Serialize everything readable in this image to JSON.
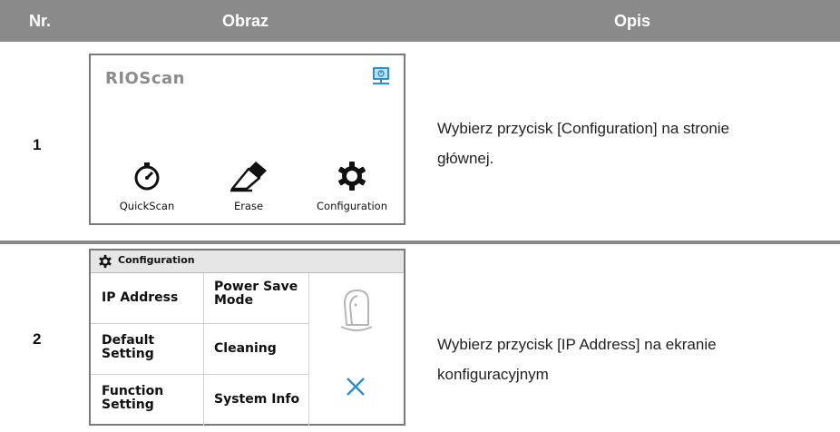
{
  "header": {
    "col_nr": "Nr.",
    "col_image": "Obraz",
    "col_desc": "Opis"
  },
  "rows": [
    {
      "nr": "1",
      "desc_line1": "Wybierz przycisk [Configuration] na stronie",
      "desc_line2": "głównej.",
      "screen": {
        "logo": "RIOScan",
        "tiles": [
          {
            "label": "QuickScan",
            "icon": "stopwatch-icon"
          },
          {
            "label": "Erase",
            "icon": "eraser-icon"
          },
          {
            "label": "Configuration",
            "icon": "gear-icon"
          }
        ]
      }
    },
    {
      "nr": "2",
      "desc_line1": "Wybierz przycisk [IP Address]   na ekranie",
      "desc_line2": "konfiguracyjnym",
      "screen": {
        "title": "Configuration",
        "buttons": {
          "ip_address": "IP Address",
          "power_save_1": "Power Save",
          "power_save_2": "Mode",
          "default_1": "Default",
          "default_2": "Setting",
          "cleaning": "Cleaning",
          "function_1": "Function",
          "function_2": "Setting",
          "system_info": "System Info"
        }
      }
    }
  ],
  "colors": {
    "header_bg": "#8a8a8a",
    "accent_blue": "#2a8fd6",
    "logo_gray": "#8c8c8c"
  }
}
